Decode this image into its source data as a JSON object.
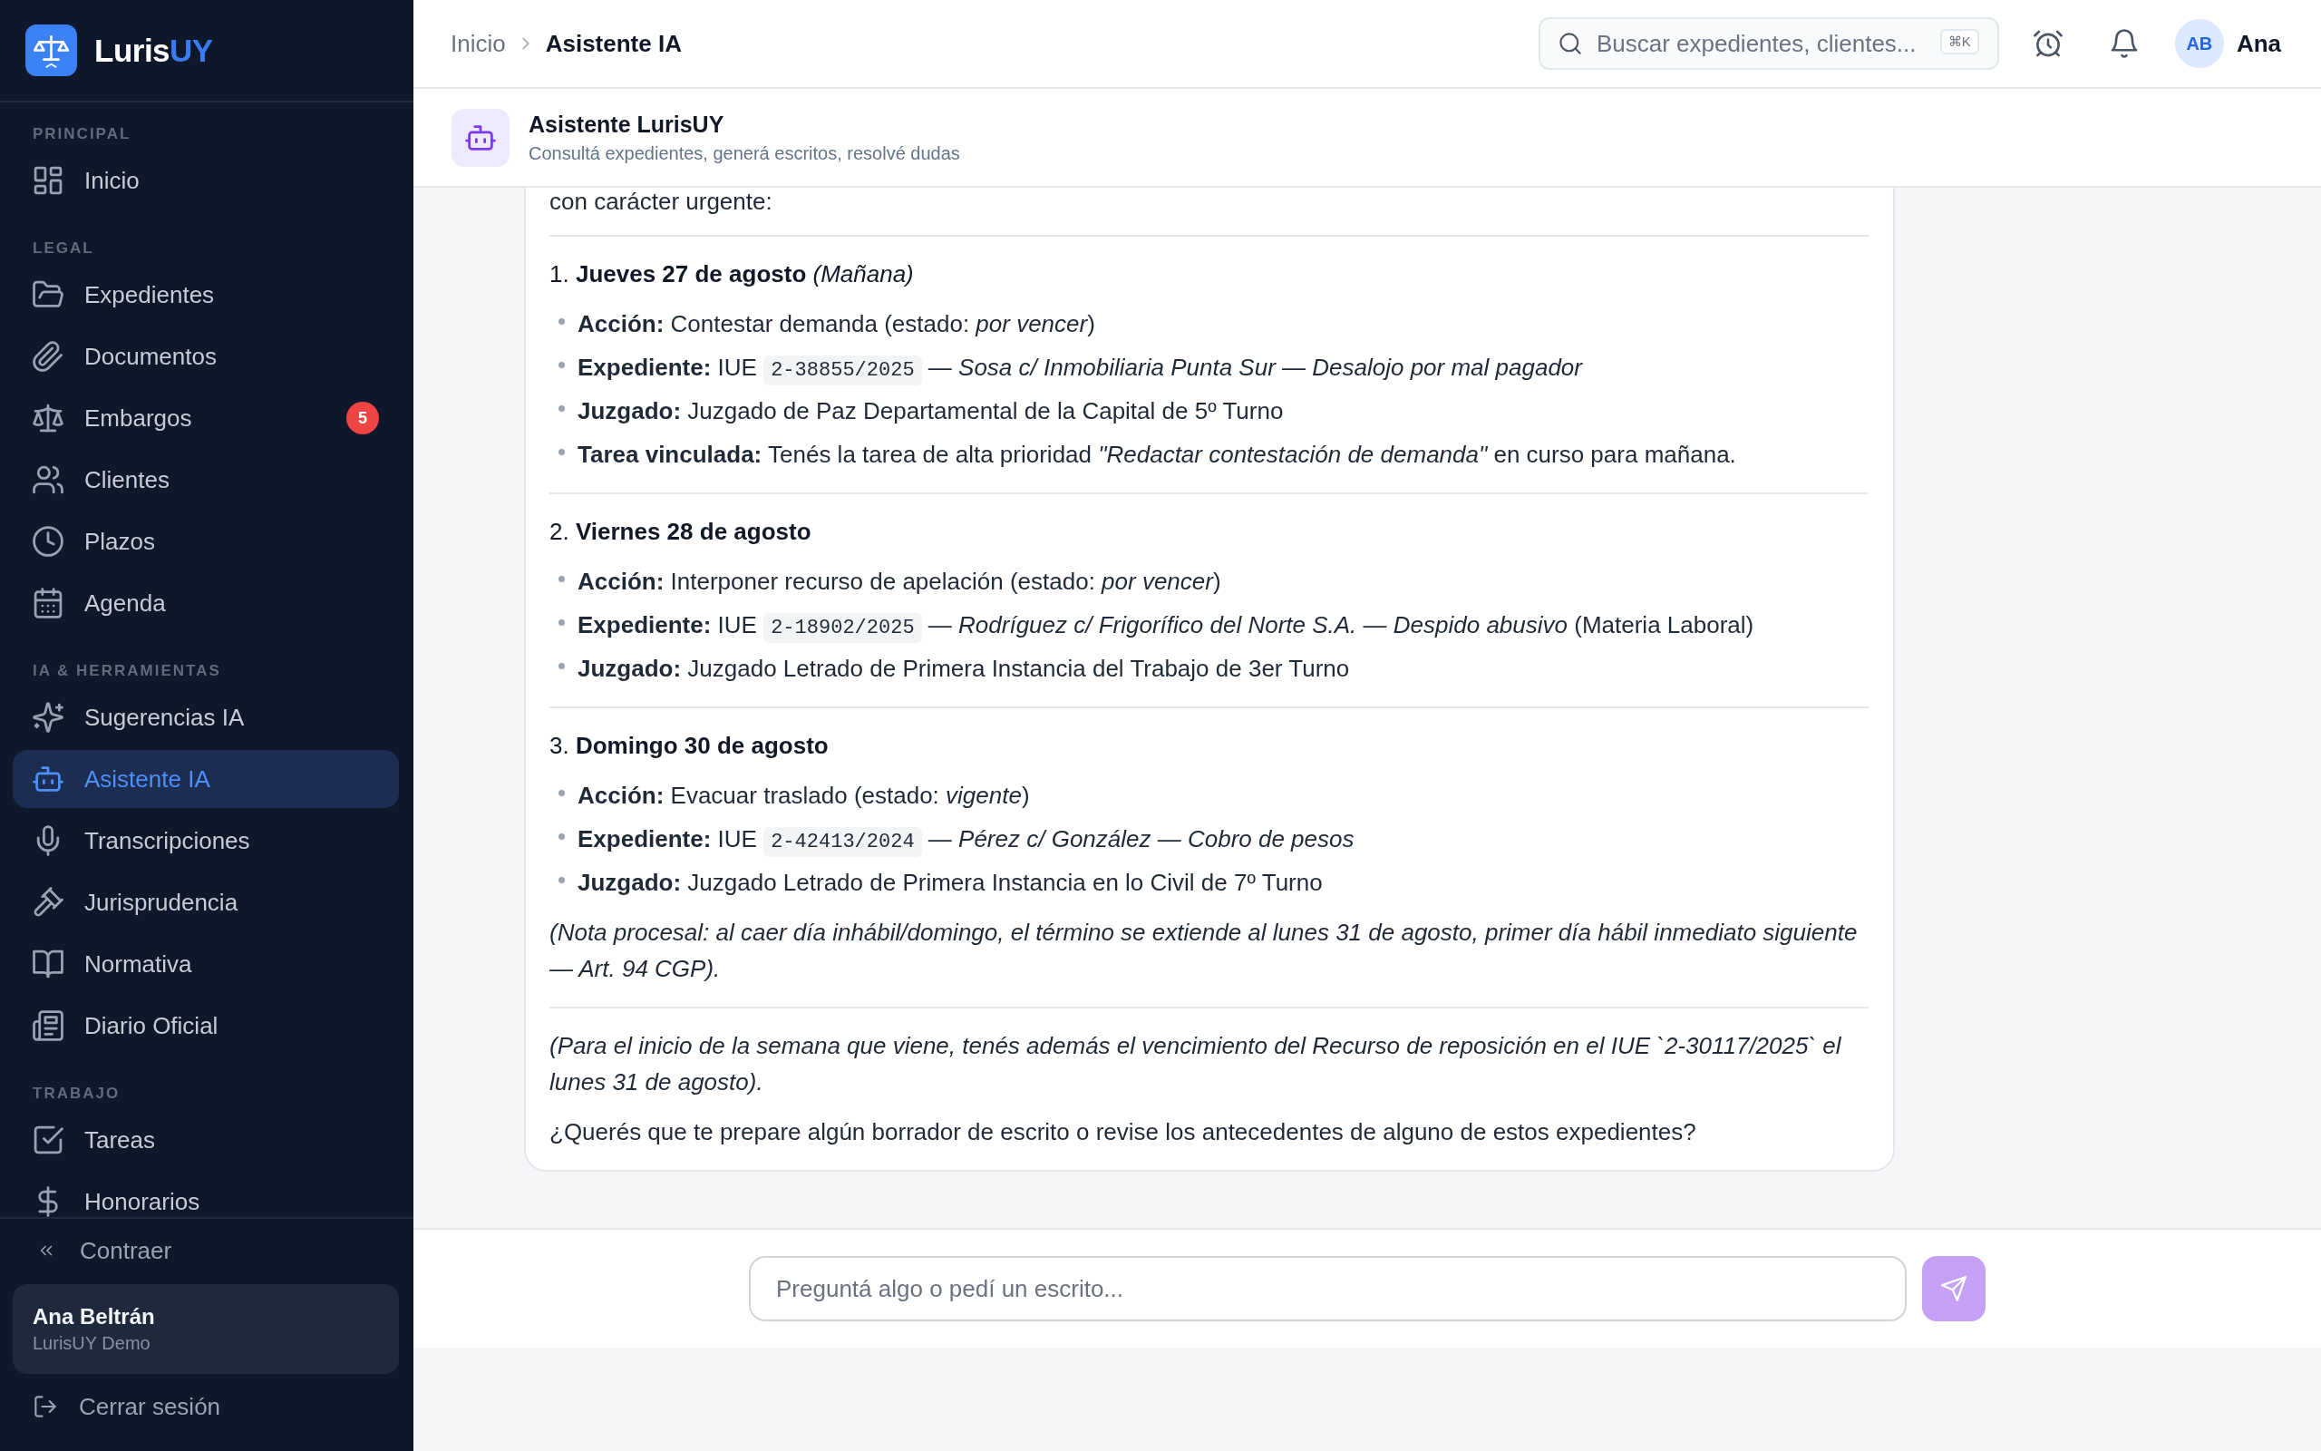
{
  "sidebar": {
    "brand": {
      "name": "Luris",
      "accent": "UY"
    },
    "sections": [
      {
        "title": "PRINCIPAL",
        "items": [
          {
            "label": "Inicio",
            "selected": false
          }
        ]
      },
      {
        "title": "LEGAL",
        "items": [
          {
            "label": "Expedientes",
            "selected": false
          },
          {
            "label": "Documentos",
            "selected": false
          },
          {
            "label": "Embargos",
            "selected": false,
            "badge": "5"
          },
          {
            "label": "Clientes",
            "selected": false
          },
          {
            "label": "Plazos",
            "selected": false
          },
          {
            "label": "Agenda",
            "selected": false
          }
        ]
      },
      {
        "title": "IA & HERRAMIENTAS",
        "items": [
          {
            "label": "Sugerencias IA",
            "selected": false
          },
          {
            "label": "Asistente IA",
            "selected": true
          },
          {
            "label": "Transcripciones",
            "selected": false
          },
          {
            "label": "Jurisprudencia",
            "selected": false
          },
          {
            "label": "Normativa",
            "selected": false
          },
          {
            "label": "Diario Oficial",
            "selected": false
          }
        ]
      },
      {
        "title": "TRABAJO",
        "items": [
          {
            "label": "Tareas",
            "selected": false
          },
          {
            "label": "Honorarios",
            "selected": false
          }
        ]
      }
    ],
    "collapse": "Contraer",
    "user": {
      "name": "Ana Beltrán",
      "organization": "LurisUY Demo"
    },
    "logout": "Cerrar sesión"
  },
  "topbar": {
    "breadcrumb": [
      {
        "label": "Inicio",
        "current": false
      },
      {
        "label": "Asistente IA",
        "current": true
      }
    ],
    "search": {
      "placeholder": "Buscar expedientes, clientes...",
      "shortcut": "⌘K"
    },
    "user": {
      "initials": "AB",
      "name": "Ana"
    }
  },
  "assistant": {
    "title": "Asistente LurisUY",
    "subtitle": "Consultá expedientes, generá escritos, resolvé dudas"
  },
  "message": {
    "blocks": [
      {
        "kind": "paragraph",
        "text": "con carácter urgente:"
      },
      {
        "kind": "rule"
      },
      {
        "kind": "heading",
        "text": "1. **Jueves 27 de agosto** *(Mañana)*"
      },
      {
        "kind": "bullets",
        "items": [
          {
            "parts": [
              {
                "kind": "text",
                "text": "**Acción:** Contestar demanda (estado: *por vencer*)"
              }
            ]
          },
          {
            "parts": [
              {
                "kind": "text",
                "text": "**Expediente:** IUE "
              },
              {
                "kind": "code",
                "text": "2-38855/2025"
              },
              {
                "kind": "text",
                "text": " — *Sosa c/ Inmobiliaria Punta Sur — Desalojo por mal pagador*"
              }
            ]
          },
          {
            "parts": [
              {
                "kind": "text",
                "text": "**Juzgado:** Juzgado de Paz Departamental de la Capital de 5º Turno"
              }
            ]
          },
          {
            "parts": [
              {
                "kind": "text",
                "text": "**Tarea vinculada:** Tenés la tarea de alta prioridad *\"Redactar contestación de demanda\"* en curso para mañana."
              }
            ]
          }
        ]
      },
      {
        "kind": "rule"
      },
      {
        "kind": "heading",
        "text": "2. **Viernes 28 de agosto**"
      },
      {
        "kind": "bullets",
        "items": [
          {
            "parts": [
              {
                "kind": "text",
                "text": "**Acción:** Interponer recurso de apelación (estado: *por vencer*)"
              }
            ]
          },
          {
            "parts": [
              {
                "kind": "text",
                "text": "**Expediente:** IUE "
              },
              {
                "kind": "code",
                "text": "2-18902/2025"
              },
              {
                "kind": "text",
                "text": " — *Rodríguez c/ Frigorífico del Norte S.A. — Despido abusivo* (Materia Laboral)"
              }
            ]
          },
          {
            "parts": [
              {
                "kind": "text",
                "text": "**Juzgado:** Juzgado Letrado de Primera Instancia del Trabajo de 3er Turno"
              }
            ]
          }
        ]
      },
      {
        "kind": "rule"
      },
      {
        "kind": "heading",
        "text": "3. **Domingo 30 de agosto**"
      },
      {
        "kind": "bullets",
        "items": [
          {
            "parts": [
              {
                "kind": "text",
                "text": "**Acción:** Evacuar traslado (estado: *vigente*)"
              }
            ]
          },
          {
            "parts": [
              {
                "kind": "text",
                "text": "**Expediente:** IUE "
              },
              {
                "kind": "code",
                "text": "2-42413/2024"
              },
              {
                "kind": "text",
                "text": " — *Pérez c/ González — Cobro de pesos*"
              }
            ]
          },
          {
            "parts": [
              {
                "kind": "text",
                "text": "**Juzgado:** Juzgado Letrado de Primera Instancia en lo Civil de 7º Turno"
              }
            ]
          }
        ]
      },
      {
        "kind": "note",
        "text": "(Nota procesal: al caer día inhábil/domingo, el término se extiende al lunes 31 de agosto, primer día hábil inmediato siguiente — Art. 94 CGP)."
      },
      {
        "kind": "rule"
      },
      {
        "kind": "note",
        "text": "(Para el inicio de la semana que viene, tenés además el vencimiento del Recurso de reposición en el IUE `2-30117/2025` el lunes 31 de agosto)."
      },
      {
        "kind": "paragraph",
        "text": "¿Querés que te prepare algún borrador de escrito o revise los antecedentes de alguno de estos expedientes?"
      }
    ]
  },
  "composer": {
    "placeholder": "Preguntá algo o pedí un escrito...",
    "send_disabled": true
  }
}
